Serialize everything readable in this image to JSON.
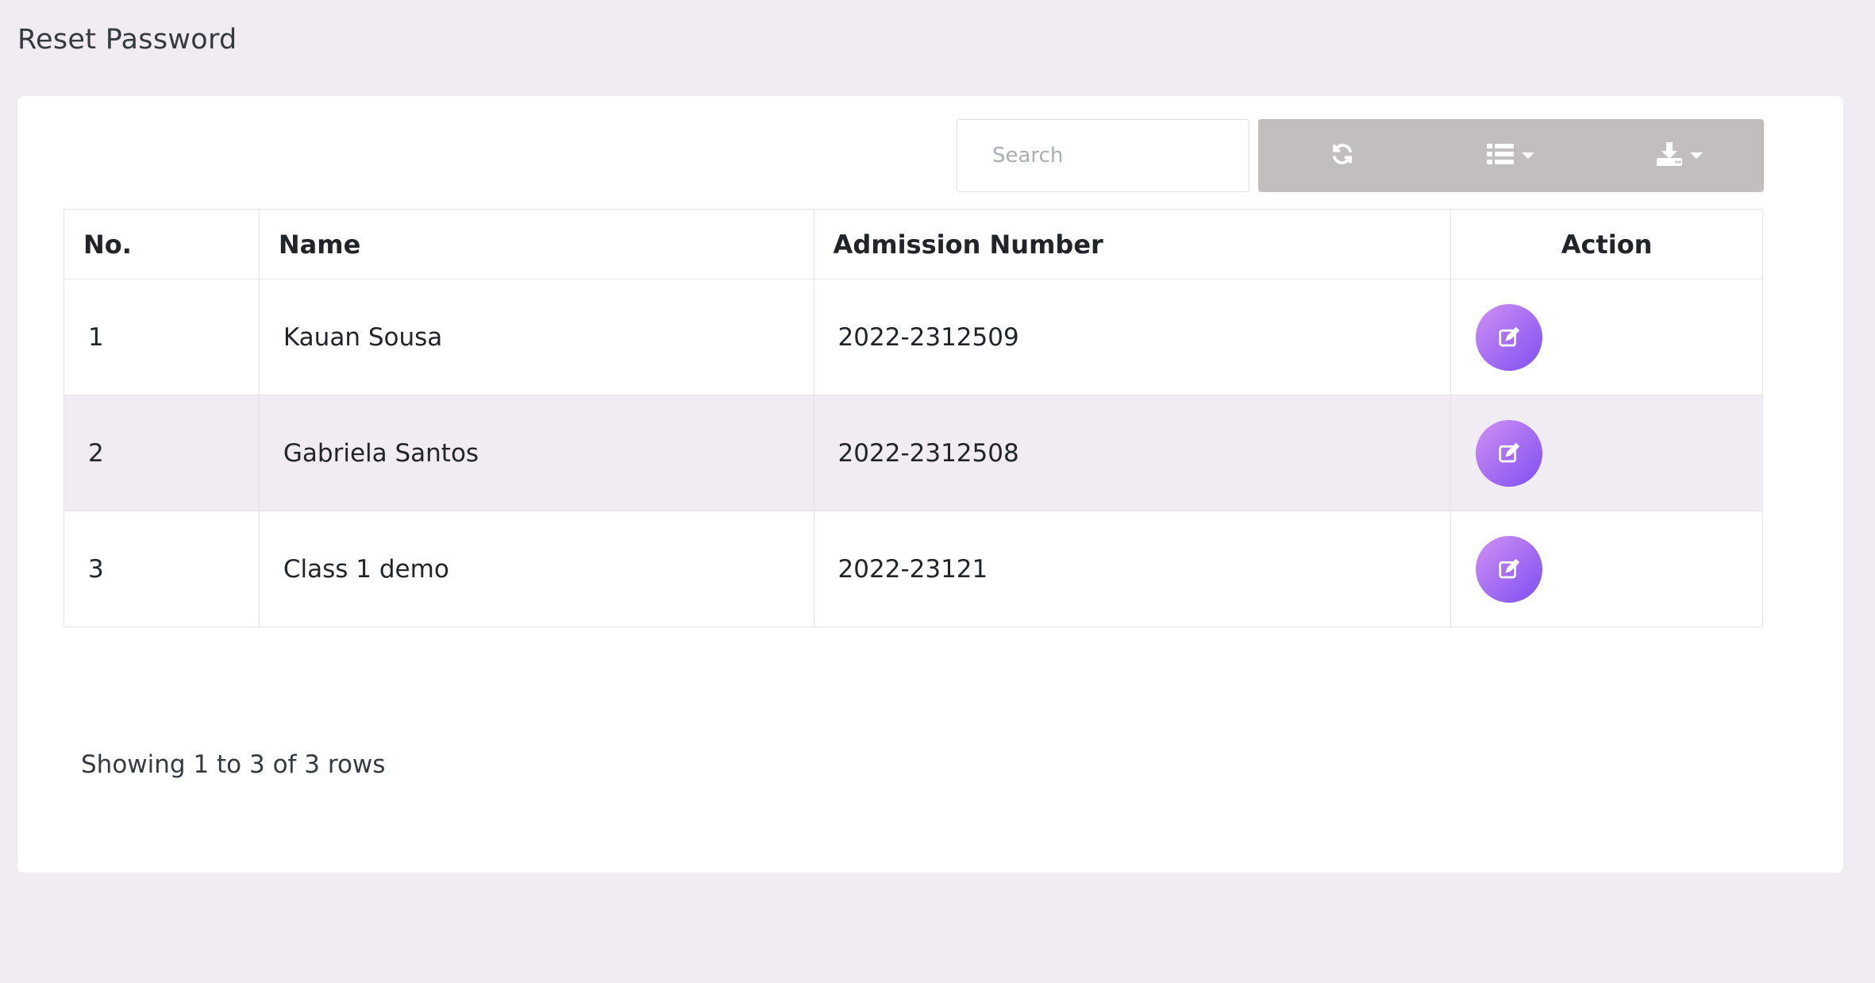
{
  "page": {
    "title": "Reset Password"
  },
  "toolbar": {
    "search_placeholder": "Search",
    "buttons": [
      {
        "icon": "refresh-icon",
        "label": ""
      },
      {
        "icon": "columns-list-icon",
        "label": ""
      },
      {
        "icon": "download-icon",
        "label": ""
      }
    ]
  },
  "table": {
    "columns": [
      "No.",
      "Name",
      "Admission Number",
      "Action"
    ],
    "rows": [
      {
        "no": "1",
        "name": "Kauan Sousa",
        "admission": "2022-2312509",
        "action_icon": "edit-icon"
      },
      {
        "no": "2",
        "name": "Gabriela Santos",
        "admission": "2022-2312508",
        "action_icon": "edit-icon"
      },
      {
        "no": "3",
        "name": "Class 1 demo",
        "admission": "2022-23121",
        "action_icon": "edit-icon"
      }
    ]
  },
  "pagination": {
    "info": "Showing 1 to 3 of 3 rows"
  },
  "colors": {
    "background": "#f1ecf3",
    "toolbar_button": "#c2bebe",
    "action_gradient_start": "#d190f4",
    "action_gradient_end": "#7d4ff0"
  }
}
